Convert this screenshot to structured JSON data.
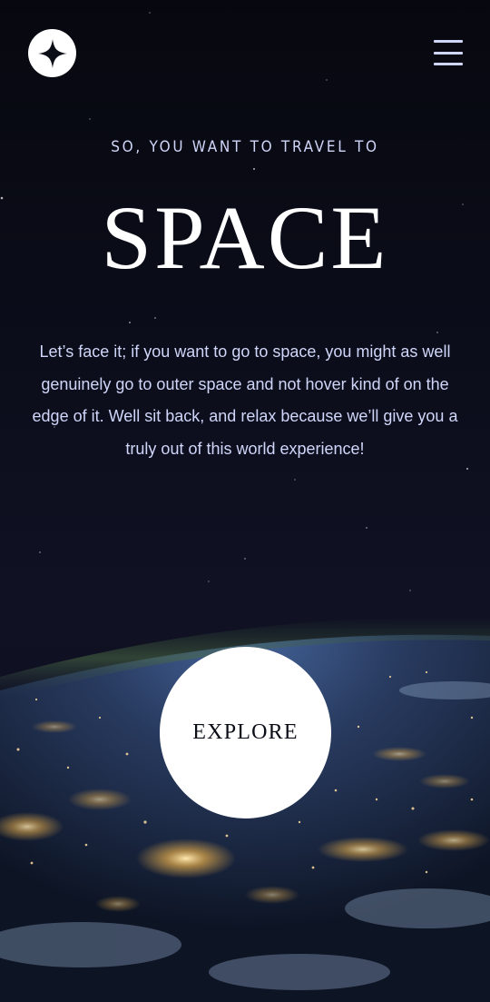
{
  "header": {
    "logo_icon": "star-logo-icon",
    "menu_icon": "hamburger-menu-icon"
  },
  "hero": {
    "eyebrow": "SO, YOU WANT TO TRAVEL TO",
    "title": "SPACE",
    "description": "Let’s face it; if you want to go to space, you might as well genuinely go to outer space and not hover kind of on the edge of it. Well sit back, and relax because we’ll give you a truly out of this world experience!"
  },
  "cta": {
    "label": "EXPLORE"
  },
  "colors": {
    "background": "#0b0d17",
    "text_light": "#d0d6f9",
    "white": "#ffffff"
  }
}
